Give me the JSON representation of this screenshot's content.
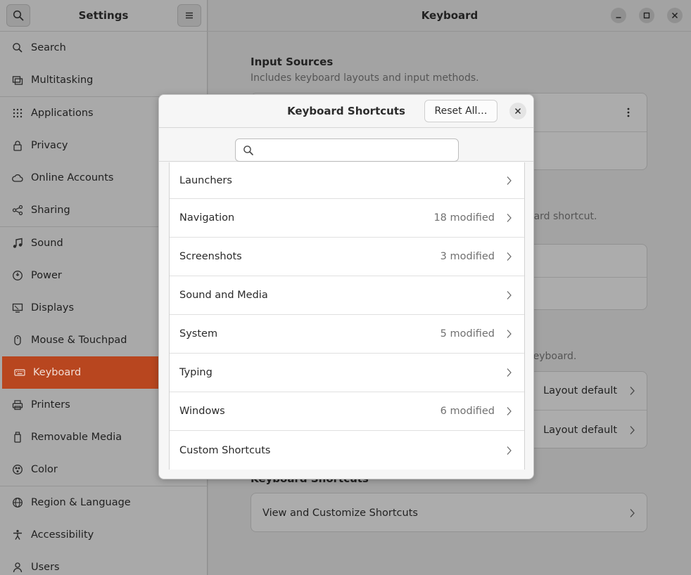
{
  "sidebar": {
    "title": "Settings",
    "items": [
      {
        "label": "Search",
        "icon": "search-icon",
        "sep_after": false
      },
      {
        "label": "Multitasking",
        "icon": "multitasking-icon",
        "sep_after": true
      },
      {
        "label": "Applications",
        "icon": "applications-icon",
        "sep_after": false
      },
      {
        "label": "Privacy",
        "icon": "privacy-icon",
        "sep_after": false
      },
      {
        "label": "Online Accounts",
        "icon": "cloud-icon",
        "sep_after": false
      },
      {
        "label": "Sharing",
        "icon": "sharing-icon",
        "sep_after": true
      },
      {
        "label": "Sound",
        "icon": "music-note-icon",
        "sep_after": false
      },
      {
        "label": "Power",
        "icon": "power-icon",
        "sep_after": false
      },
      {
        "label": "Displays",
        "icon": "display-icon",
        "sep_after": false
      },
      {
        "label": "Mouse & Touchpad",
        "icon": "mouse-icon",
        "sep_after": false
      },
      {
        "label": "Keyboard",
        "icon": "keyboard-icon",
        "sep_after": false
      },
      {
        "label": "Printers",
        "icon": "printer-icon",
        "sep_after": false
      },
      {
        "label": "Removable Media",
        "icon": "removable-media-icon",
        "sep_after": false
      },
      {
        "label": "Color",
        "icon": "color-icon",
        "sep_after": true
      },
      {
        "label": "Region & Language",
        "icon": "globe-icon",
        "sep_after": false
      },
      {
        "label": "Accessibility",
        "icon": "accessibility-icon",
        "sep_after": false
      },
      {
        "label": "Users",
        "icon": "users-icon",
        "sep_after": false
      }
    ],
    "active_index": 10
  },
  "main": {
    "title": "Keyboard",
    "input_sources": {
      "title": "Input Sources",
      "subtitle": "Includes keyboard layouts and input methods."
    },
    "partial_subtitle_1": "oard shortcut.",
    "partial_subtitle_2": "keyboard.",
    "layout_rows": [
      {
        "value": "Layout default"
      },
      {
        "value": "Layout default"
      }
    ],
    "shortcuts_section": {
      "title": "Keyboard Shortcuts",
      "row_label": "View and Customize Shortcuts"
    }
  },
  "dialog": {
    "title": "Keyboard Shortcuts",
    "reset_label": "Reset All…",
    "search_placeholder": "",
    "categories": [
      {
        "name": "Launchers",
        "modified": ""
      },
      {
        "name": "Navigation",
        "modified": "18 modified"
      },
      {
        "name": "Screenshots",
        "modified": "3 modified"
      },
      {
        "name": "Sound and Media",
        "modified": ""
      },
      {
        "name": "System",
        "modified": "5 modified"
      },
      {
        "name": "Typing",
        "modified": ""
      },
      {
        "name": "Windows",
        "modified": "6 modified"
      },
      {
        "name": "Custom Shortcuts",
        "modified": ""
      }
    ]
  },
  "colors": {
    "accent": "#b8461f"
  }
}
